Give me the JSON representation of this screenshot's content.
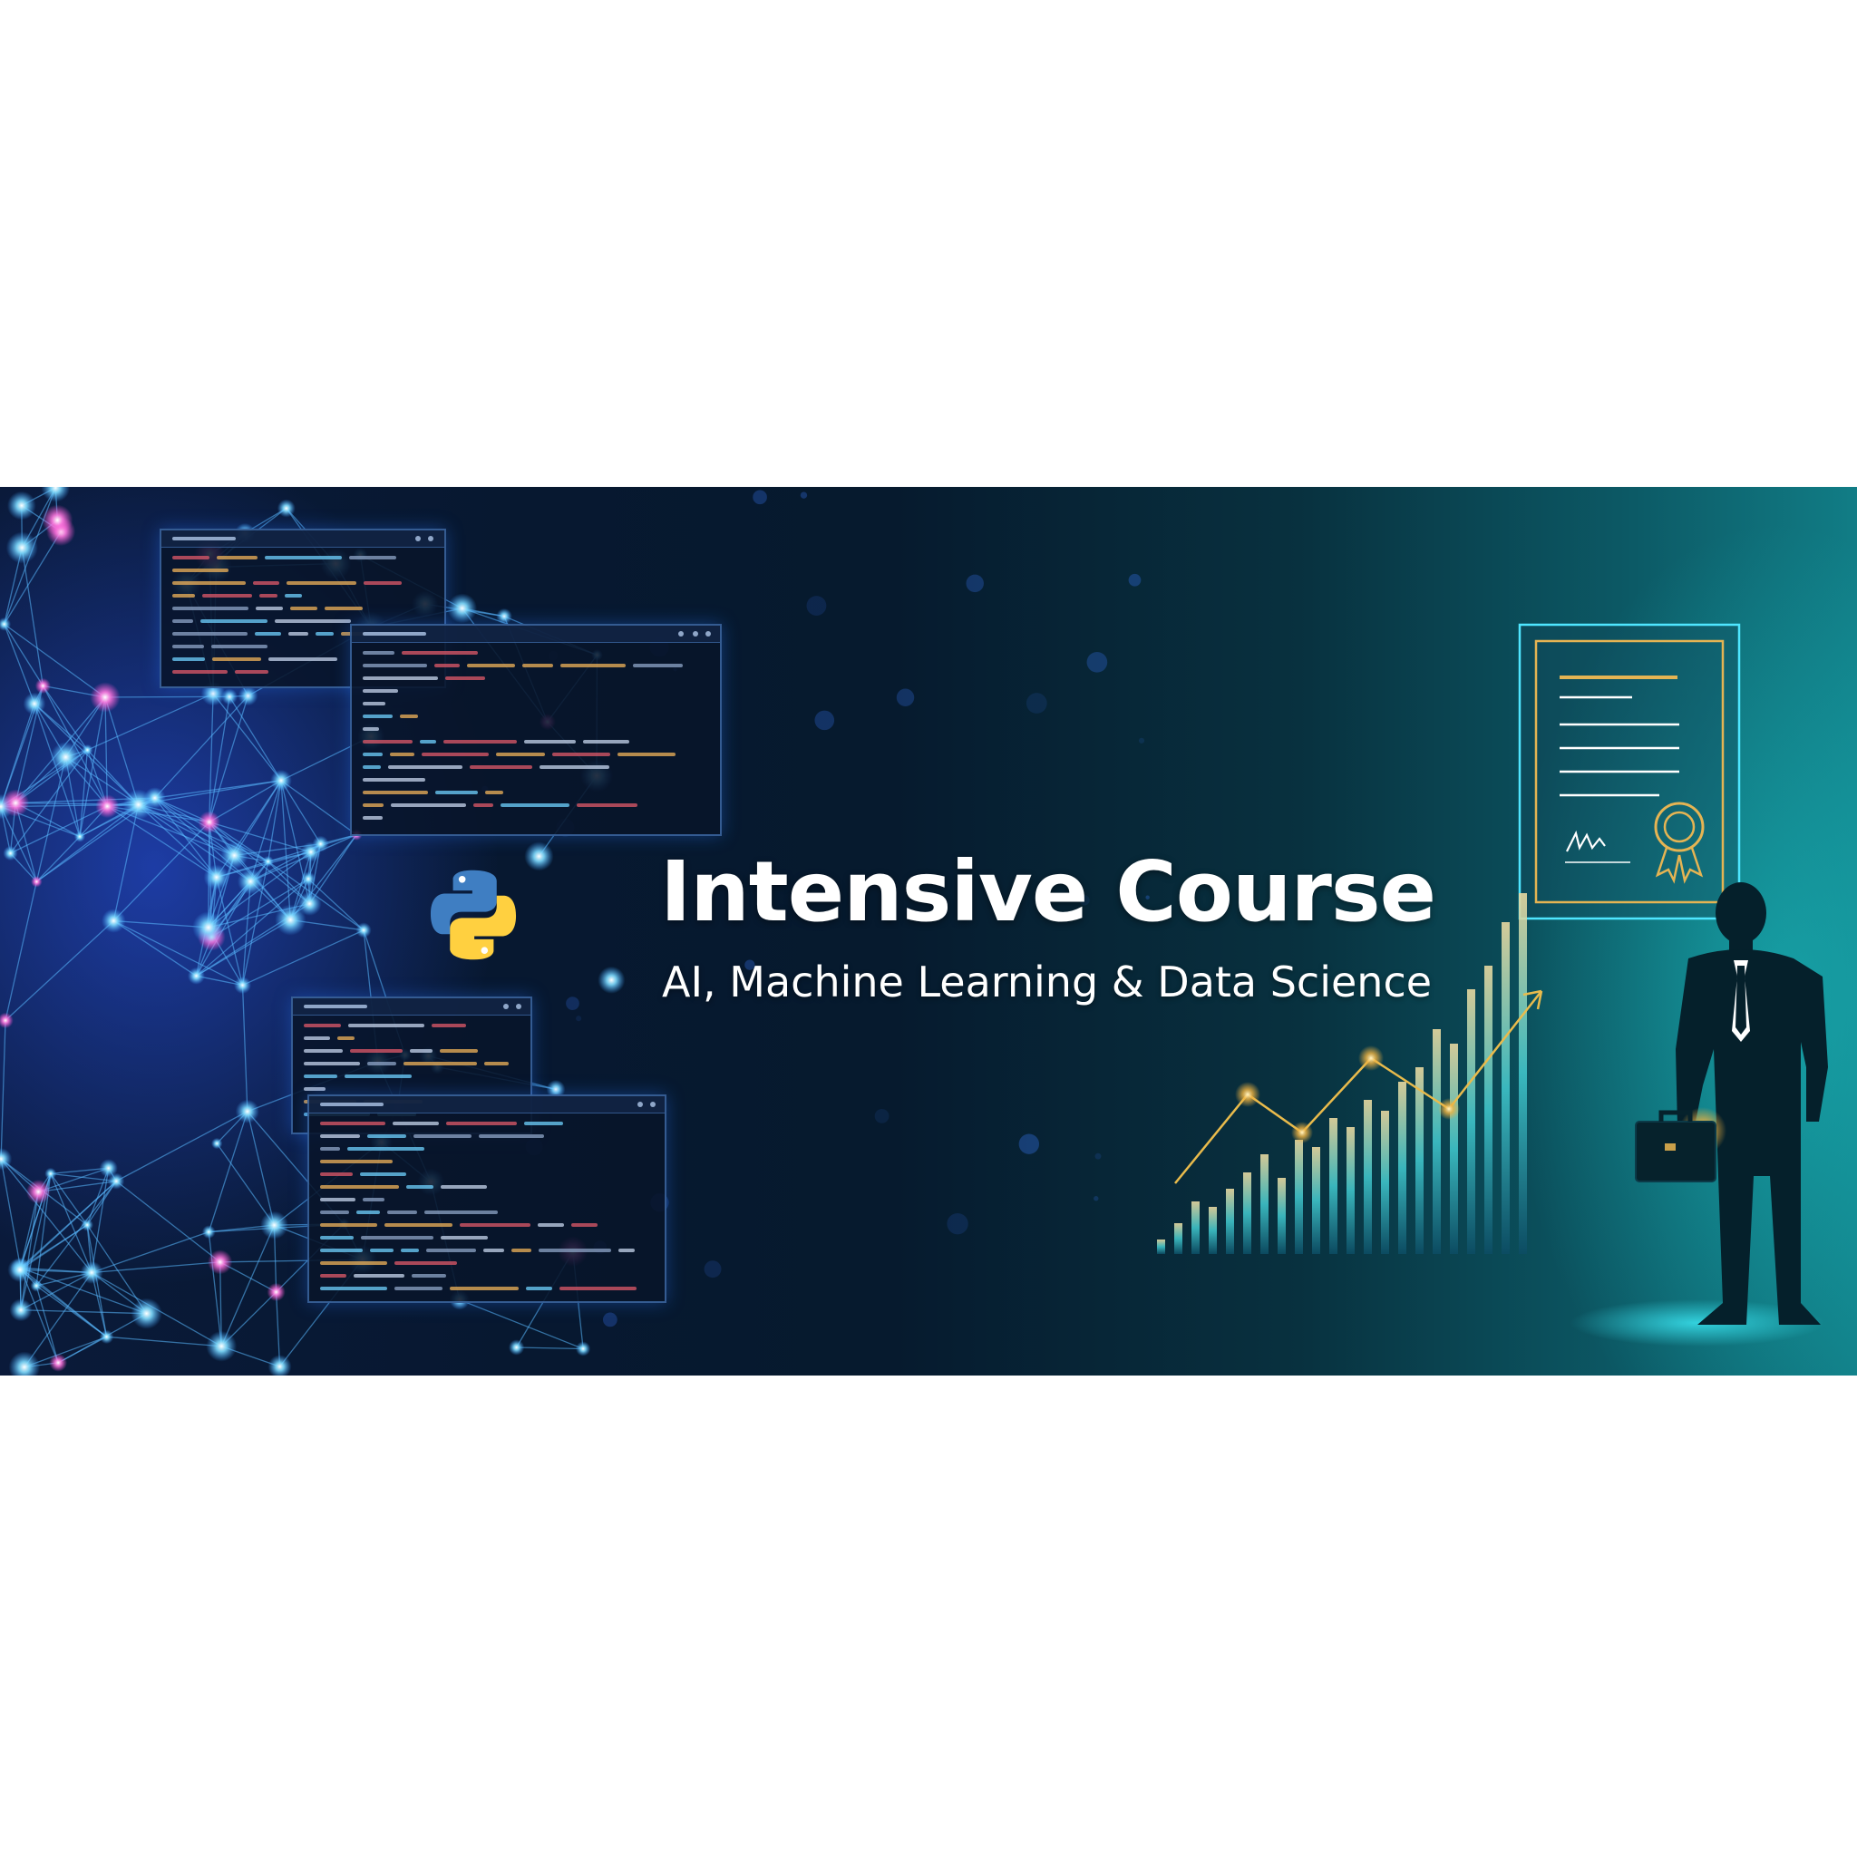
{
  "banner": {
    "title": "Intensive Course",
    "subtitle": "AI, Machine Learning & Data Science"
  },
  "colors": {
    "text": "#ffffff",
    "node_blue": "#55c8ff",
    "node_pink": "#ff6ad5",
    "gold": "#e9bb4c",
    "teal_glow": "#17b8c4",
    "python_blue": "#3f7ec2",
    "python_yellow": "#ffd040"
  },
  "icons": [
    "neural-network-graphic",
    "code-window-icon",
    "python-logo-icon",
    "certificate-icon",
    "award-seal-icon",
    "growth-chart-icon",
    "businessman-silhouette",
    "briefcase-icon"
  ]
}
